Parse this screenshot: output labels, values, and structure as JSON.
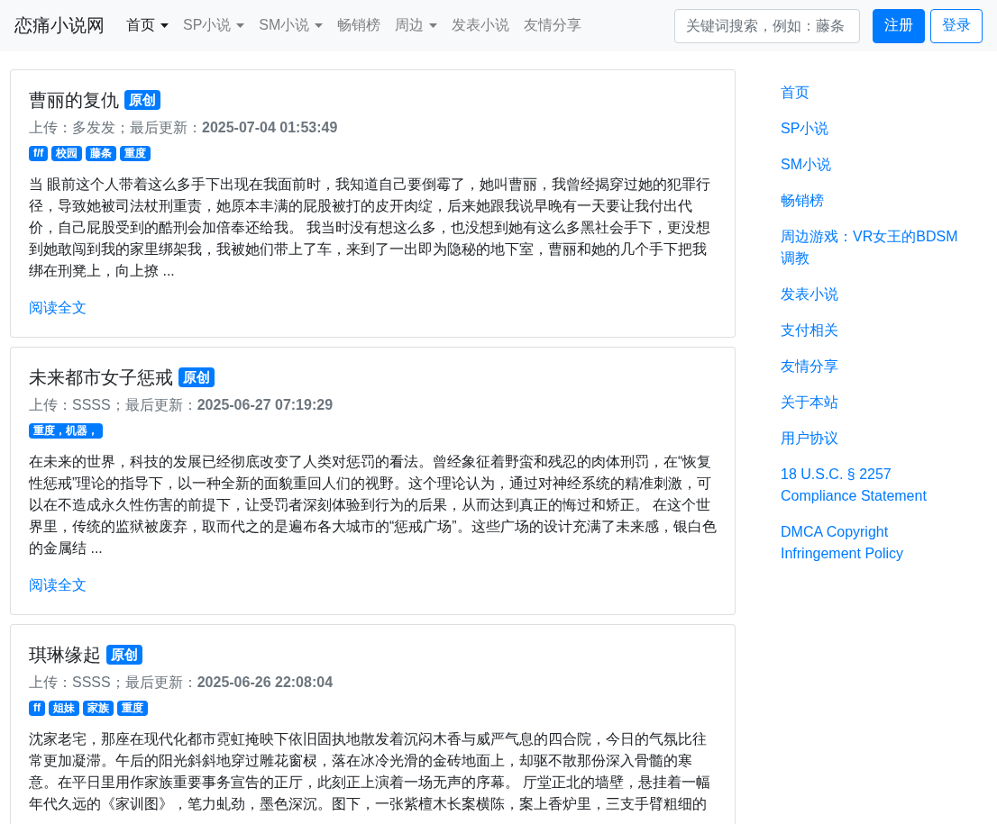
{
  "navbar": {
    "brand": "恋痛小说网",
    "items": [
      {
        "label": "首页",
        "selected": true,
        "dropdown": true
      },
      {
        "label": "SP小说",
        "selected": false,
        "dropdown": true
      },
      {
        "label": "SM小说",
        "selected": false,
        "dropdown": true
      },
      {
        "label": "畅销榜",
        "selected": false,
        "dropdown": false
      },
      {
        "label": "周边",
        "selected": false,
        "dropdown": true
      },
      {
        "label": "发表小说",
        "selected": false,
        "dropdown": false
      },
      {
        "label": "友情分享",
        "selected": false,
        "dropdown": false
      }
    ],
    "search": {
      "placeholder": "关键词搜索，例如：藤条"
    },
    "buttons": [
      {
        "label": "注册",
        "kind": "primary"
      },
      {
        "label": "登录",
        "kind": "outline"
      }
    ]
  },
  "novels": [
    {
      "title": "曹丽的复仇",
      "badge": "原创",
      "meta": "上传：多发发；最后更新：**2025-07-04 01:53:49**",
      "tags": [
        "f/f",
        "校园",
        "藤条",
        "重度"
      ],
      "excerpt": "当 眼前这个人带着这么多手下出现在我面前时，我知道自己要倒霉了，她叫曹丽，我曾经揭穿过她的犯罪行径，导致她被司法杖刑重责，她原本丰满的屁股被打的皮开肉绽，后来她跟我说早晚有一天要让我付出代价，自己屁股受到的酷刑会加倍奉还给我。 我当时没有想这么多，也没想到她有这么多黑社会手下，更没想到她敢闯到我的家里绑架我，我被她们带上了车，来到了一出即为隐秘的地下室，曹丽和她的几个手下把我绑在刑凳上，向上撩 ...",
      "read_more": "阅读全文"
    },
    {
      "title": "未来都市女子惩戒",
      "badge": "原创",
      "meta": "上传：SSSS；最后更新：**2025-06-27 07:19:29**",
      "tags": [
        "重度，机器，"
      ],
      "excerpt": "在未来的世界，科技的发展已经彻底改变了人类对惩罚的看法。曾经象征着野蛮和残忍的肉体刑罚，在“恢复性惩戒”理论的指导下，以一种全新的面貌重回人们的视野。这个理论认为，通过对神经系统的精准刺激，可以在不造成永久性伤害的前提下，让受罚者深刻体验到行为的后果，从而达到真正的悔过和矫正。 在这个世界里，传统的监狱被废弃，取而代之的是遍布各大城市的“惩戒广场”。这些广场的设计充满了未来感，银白色的金属结 ...",
      "read_more": "阅读全文"
    },
    {
      "title": "琪琳缘起",
      "badge": "原创",
      "meta": "上传：SSSS；最后更新：**2025-06-26 22:08:04**",
      "tags": [
        "ff",
        "姐妹",
        "家族",
        "重度"
      ],
      "excerpt": "沈家老宅，那座在现代化都市霓虹掩映下依旧固执地散发着沉闷木香与威严气息的四合院，今日的气氛比往常更加凝滞。午后的阳光斜斜地穿过雕花窗棂，落在冰冷光滑的金砖地面上，却驱不散那份深入骨髓的寒意。在平日里用作家族重要事务宣告的正厅，此刻正上演着一场无声的序幕。 厅堂正北的墙壁，悬挂着一幅年代久远的《家训图》，笔力虬劲，墨色深沉。图下，一张紫檀木长案横陈，案上香炉里，三支手臂粗细的"
    }
  ],
  "sidebar": {
    "links": [
      "首页",
      "SP小说",
      "SM小说",
      "畅销榜",
      "周边游戏：VR女王的BDSM调教",
      "发表小说",
      "支付相关",
      "友情分享",
      "关于本站",
      "用户协议",
      "18 U.S.C. § 2257 Compliance Statement",
      "DMCA Copyright Infringement Policy"
    ]
  }
}
